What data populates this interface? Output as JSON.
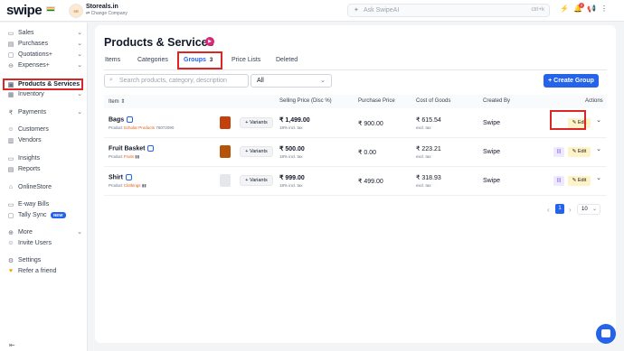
{
  "topbar": {
    "logo": "swipe",
    "company_initials": "SR",
    "company_name": "Storeals.in",
    "change_company": "⇄ Change Company",
    "search_placeholder": "Ask SwipeAI",
    "search_shortcut": "ctrl+k",
    "notification_count": "2"
  },
  "sidebar": {
    "items": [
      {
        "label": "Sales",
        "icon": "sales-icon",
        "chevron": true
      },
      {
        "label": "Purchases",
        "icon": "purchases-icon",
        "chevron": true
      },
      {
        "label": "Quotations+",
        "icon": "quotations-icon",
        "chevron": true
      },
      {
        "label": "Expenses+",
        "icon": "expenses-icon",
        "chevron": true
      },
      {
        "label": "Products & Services",
        "icon": "products-icon",
        "active": true
      },
      {
        "label": "Inventory",
        "icon": "inventory-icon",
        "chevron": true
      },
      {
        "label": "Payments",
        "icon": "rupee-icon",
        "chevron": true
      },
      {
        "label": "Customers",
        "icon": "customers-icon"
      },
      {
        "label": "Vendors",
        "icon": "vendors-icon"
      },
      {
        "label": "Insights",
        "icon": "insights-icon"
      },
      {
        "label": "Reports",
        "icon": "reports-icon"
      },
      {
        "label": "OnlineStore",
        "icon": "store-icon"
      },
      {
        "label": "E-way Bills",
        "icon": "eway-icon"
      },
      {
        "label": "Tally Sync",
        "icon": "tally-icon",
        "badge": "NEW"
      },
      {
        "label": "More",
        "icon": "more-icon",
        "chevron": true
      },
      {
        "label": "Invite Users",
        "icon": "invite-icon"
      },
      {
        "label": "Settings",
        "icon": "settings-icon"
      },
      {
        "label": "Refer a friend",
        "icon": "refer-icon"
      }
    ]
  },
  "main": {
    "title": "Products & Services",
    "tabs": [
      {
        "label": "Items"
      },
      {
        "label": "Categories"
      },
      {
        "label": "Groups",
        "count": "3",
        "active": true
      },
      {
        "label": "Price Lists"
      },
      {
        "label": "Deleted"
      }
    ],
    "search_placeholder": "Search products, category, description",
    "filter_value": "All",
    "create_button": "+ Create Group",
    "table": {
      "headers": {
        "item": "Item",
        "selling_price": "Selling Price (Disc %)",
        "purchase_price": "Purchase Price",
        "cost_of_goods": "Cost of Goods",
        "created_by": "Created By",
        "actions": "Actions"
      },
      "rows": [
        {
          "name": "Bags",
          "sub_prefix": "Product",
          "category": "Scholar Products",
          "sub_code": "76072090",
          "variants": "+ Variants",
          "selling_price": "₹ 1,499.00",
          "selling_sub": "18% incl. tax",
          "purchase_price": "₹ 900.00",
          "cogs": "₹ 615.54",
          "cogs_sub": "excl. tax",
          "created_by": "Swipe",
          "edit": "Edit",
          "thumb_color": "#c2410c"
        },
        {
          "name": "Fruit Basket",
          "sub_prefix": "Product",
          "category": "Fruits",
          "sub_code": "",
          "variants": "+ Variants",
          "selling_price": "₹ 500.00",
          "selling_sub": "18% incl. tax",
          "purchase_price": "₹ 0.00",
          "cogs": "₹ 223.21",
          "cogs_sub": "excl. tax",
          "created_by": "Swipe",
          "edit": "Edit",
          "thumb_color": "#b45309"
        },
        {
          "name": "Shirt",
          "sub_prefix": "Product",
          "category": "Clothings",
          "sub_code": "",
          "variants": "+ Variants",
          "selling_price": "₹ 999.00",
          "selling_sub": "18% incl. tax",
          "purchase_price": "₹ 499.00",
          "cogs": "₹ 318.93",
          "cogs_sub": "excl. tax",
          "created_by": "Swipe",
          "edit": "Edit",
          "thumb_color": "#e5e7eb"
        }
      ]
    },
    "pagination": {
      "current_page": "1",
      "page_size": "10"
    }
  },
  "colors": {
    "accent": "#2563eb",
    "highlight": "#dc2626",
    "edit_bg": "#fef3c7"
  }
}
